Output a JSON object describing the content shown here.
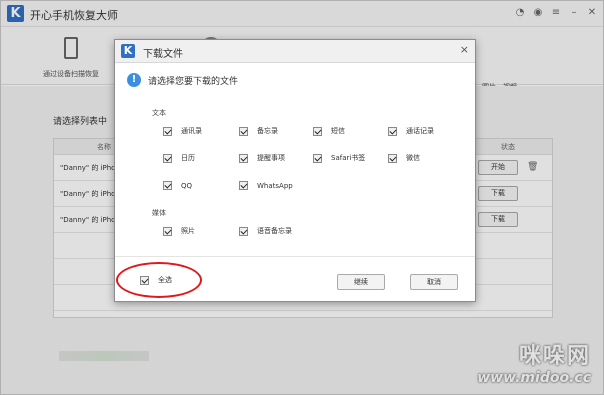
{
  "app": {
    "title": "开心手机恢复大师",
    "logo": "K",
    "titlebar_icons": [
      "wechat-icon",
      "chat-icon",
      "menu-icon",
      "minimize-icon",
      "close-icon"
    ]
  },
  "toolbar": {
    "scan_label": "通过设备扫描恢复",
    "side_text": "讯录、图片、视频、"
  },
  "main": {
    "list_title": "请选择列表中",
    "columns": {
      "name": "名称",
      "status": "状态"
    },
    "rows": [
      {
        "name": "\"Danny\" 的 iPho",
        "action": "开始",
        "trash": true
      },
      {
        "name": "\"Danny\" 的 iPho",
        "action": "下载",
        "trash": false
      },
      {
        "name": "\"Danny\" 的 iPho",
        "action": "下载",
        "trash": false
      }
    ]
  },
  "watermark": {
    "line1": "咪哚网",
    "line2": "www.midoo.cc"
  },
  "dialog": {
    "title": "下载文件",
    "logo": "K",
    "close": "×",
    "prompt": "请选择您要下载的文件",
    "text_section": "文本",
    "media_section": "媒体",
    "text_options": [
      {
        "label": "通讯录",
        "checked": true
      },
      {
        "label": "备忘录",
        "checked": true
      },
      {
        "label": "短信",
        "checked": true
      },
      {
        "label": "通话记录",
        "checked": true
      },
      {
        "label": "日历",
        "checked": true
      },
      {
        "label": "提醒事项",
        "checked": true
      },
      {
        "label": "Safari书签",
        "checked": true
      },
      {
        "label": "微信",
        "checked": true
      },
      {
        "label": "QQ",
        "checked": true
      },
      {
        "label": "WhatsApp",
        "checked": true
      }
    ],
    "media_options": [
      {
        "label": "照片",
        "checked": true
      },
      {
        "label": "语音备忘录",
        "checked": true
      }
    ],
    "select_all": {
      "label": "全选",
      "checked": true
    },
    "continue_label": "继续",
    "cancel_label": "取消",
    "highlight_color": "#e0181b"
  }
}
